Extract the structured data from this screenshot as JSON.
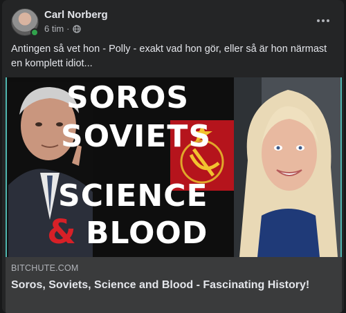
{
  "post": {
    "author": "Carl Norberg",
    "time": "6 tim",
    "dot": "·",
    "text": "Antingen så vet hon - Polly - exakt vad hon gör, eller så är hon närmast en komplett idiot...",
    "avatar_icon": "profile-photo",
    "privacy_icon": "globe-icon",
    "more_icon": "more-options-icon"
  },
  "thumbnail": {
    "line1": "SOROS",
    "line2": "SOVIETS",
    "line3": "SCIENCE",
    "amp": "&",
    "line4": "BLOOD",
    "flag_icon": "hammer-sickle-icon"
  },
  "link": {
    "domain": "BITCHUTE.COM",
    "title": "Soros, Soviets, Science and Blood - Fascinating History!"
  },
  "colors": {
    "background": "#242526",
    "link_footer": "#3a3b3c",
    "online": "#31a24c",
    "accent_red": "#d72027"
  }
}
